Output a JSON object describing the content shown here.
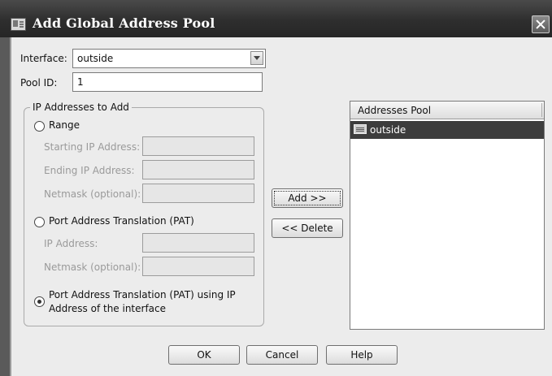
{
  "window": {
    "title": "Add Global Address Pool",
    "close_icon": "close-icon",
    "app_icon": "dialog-icon"
  },
  "interface": {
    "label": "Interface:",
    "value": "outside"
  },
  "pool_id": {
    "label": "Pool ID:",
    "value": "1"
  },
  "ip_group": {
    "legend": "IP Addresses to Add",
    "range": {
      "label": "Range",
      "checked": false,
      "starting_ip_label": "Starting IP Address:",
      "starting_ip_value": "",
      "ending_ip_label": "Ending  IP Address:",
      "ending_ip_value": "",
      "netmask_label": "Netmask (optional):",
      "netmask_value": ""
    },
    "pat": {
      "label": "Port Address Translation (PAT)",
      "checked": false,
      "ip_label": "IP Address:",
      "ip_value": "",
      "netmask_label": "Netmask (optional):",
      "netmask_value": ""
    },
    "pat_interface": {
      "label_line1": "Port Address Translation (PAT) using IP",
      "label_line2": "Address of the interface",
      "checked": true
    }
  },
  "actions": {
    "add_label": "Add >>",
    "delete_label": "<< Delete"
  },
  "pool": {
    "header": "Addresses Pool",
    "items": [
      {
        "label": "outside",
        "icon": "interface-icon",
        "selected": true
      }
    ]
  },
  "footer": {
    "ok_label": "OK",
    "cancel_label": "Cancel",
    "help_label": "Help"
  },
  "colors": {
    "titlebar": "#2e2e2e",
    "selection": "#3d3d3d",
    "dialog_bg": "#ececec"
  }
}
